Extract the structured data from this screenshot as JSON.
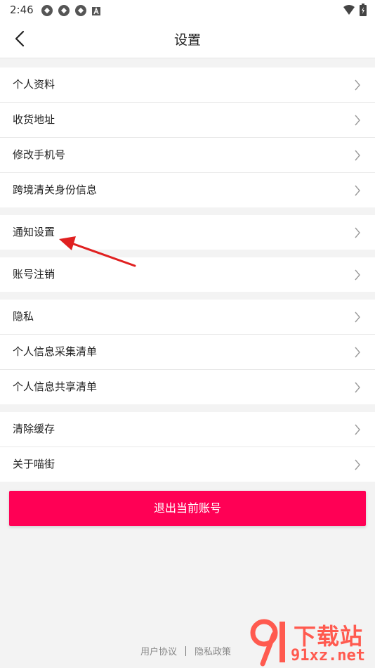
{
  "status_bar": {
    "time": "2:46",
    "left_icons": [
      "notification-icon",
      "notification-icon",
      "notification-icon",
      "a-icon"
    ],
    "right_icons": [
      "wifi-icon",
      "battery-icon"
    ]
  },
  "nav": {
    "title": "设置",
    "back_icon": "chevron-left-icon"
  },
  "groups": [
    {
      "items": [
        "个人资料",
        "收货地址",
        "修改手机号",
        "跨境清关身份信息"
      ]
    },
    {
      "items": [
        "通知设置"
      ]
    },
    {
      "items": [
        "账号注销"
      ]
    },
    {
      "items": [
        "隐私",
        "个人信息采集清单",
        "个人信息共享清单"
      ]
    },
    {
      "items": [
        "清除缓存",
        "关于喵街"
      ]
    }
  ],
  "logout_label": "退出当前账号",
  "footer": {
    "user_agreement": "用户协议",
    "privacy_policy": "隐私政策"
  },
  "watermark": {
    "top_text": "下载站",
    "bottom_text": "91xz.net"
  },
  "colors": {
    "accent": "#ff0055",
    "annotation_arrow": "#e02020",
    "watermark": "#ff5a4f"
  }
}
